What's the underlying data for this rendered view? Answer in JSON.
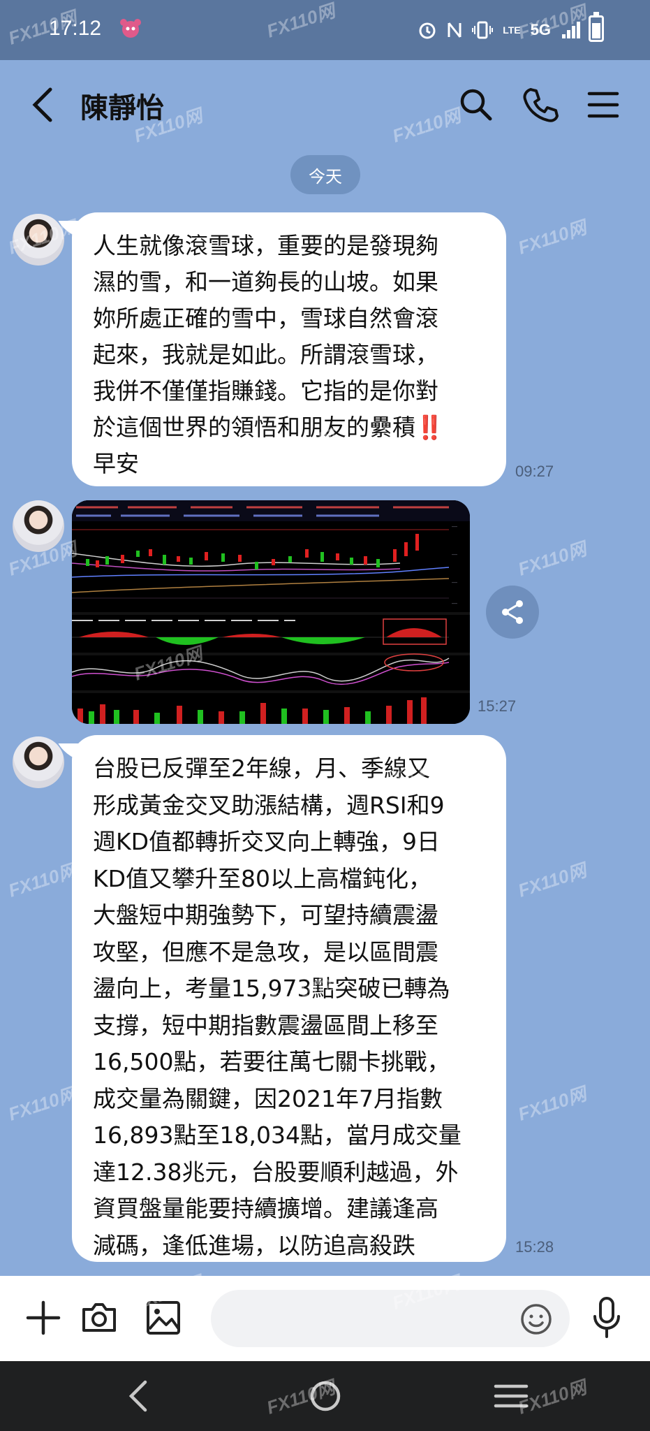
{
  "status_bar": {
    "time": "17:12",
    "network_label": "5G",
    "lte_label": "LTE"
  },
  "header": {
    "title": "陳靜怡",
    "icons": [
      "back-icon",
      "search-icon",
      "phone-icon",
      "menu-icon"
    ]
  },
  "date_divider": "今天",
  "messages": [
    {
      "type": "text",
      "text": "人生就像滾雪球，重要的是發現夠\n濕的雪，和一道夠長的山坡。如果\n妳所處正確的雪中，雪球自然會滾\n起來，我就是如此。所謂滾雪球，\n我併不僅僅指賺錢。它指的是你對\n於這個世界的領悟和朋友的纍積‼️\n早安",
      "time": "09:27"
    },
    {
      "type": "image",
      "description_icon": "stock-chart-image",
      "time": "15:27"
    },
    {
      "type": "text",
      "text": "台股已反彈至2年線，月、季線又\n形成黃金交叉助漲結構，週RSI和9\n週KD值都轉折交叉向上轉強，9日\nKD值又攀升至80以上高檔鈍化，\n大盤短中期強勢下，可望持續震盪\n攻堅，但應不是急攻，是以區間震\n盪向上，考量15,973點突破已轉為\n支撐，短中期指數震盪區間上移至\n16,500點，若要往萬七關卡挑戰，\n成交量為關鍵，因2021年7月指數\n16,893點至18,034點，當月成交量\n達12.38兆元，台股要順利越過，外\n資買盤量能要持續擴增。建議逢高\n減碼，逢低進場，以防追高殺跌",
      "time": "15:28"
    }
  ],
  "input_bar": {
    "placeholder": "",
    "icons": [
      "plus-icon",
      "camera-icon",
      "image-icon",
      "emoji-icon",
      "mic-icon"
    ]
  },
  "watermark_text": "FX110网",
  "colors": {
    "chat_background": "#8aabda",
    "status_bar": "#5a769e",
    "bubble": "#ffffff",
    "date_pill": "#7092c0",
    "nav_bar": "#1f2021"
  }
}
